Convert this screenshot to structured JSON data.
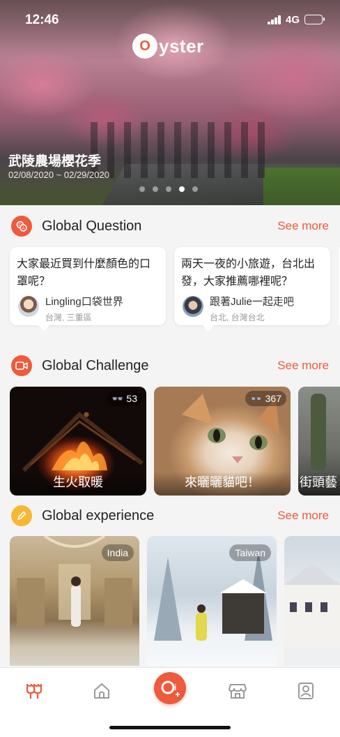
{
  "status_bar": {
    "time": "12:46",
    "network": "4G"
  },
  "brand": {
    "logo_mark": "O",
    "logo_text": "yster"
  },
  "hero": {
    "title": "武陵農場櫻花季",
    "date_range": "02/08/2020 ~ 02/29/2020",
    "pager": {
      "count": 5,
      "active_index": 3
    }
  },
  "colors": {
    "accent": "#ee5a3c",
    "experience_icon": "#f7b733"
  },
  "question": {
    "title": "Global Question",
    "see_more": "See more",
    "icon": "qa-bubbles-icon",
    "cards": [
      {
        "text": "大家最近買到什麼顏色的口罩呢？",
        "user": "Lingling口袋世界",
        "location": "台灣, 三重區"
      },
      {
        "text": "兩天一夜的小旅遊，台北出發，大家推薦哪裡呢？",
        "user": "跟著Julie一起走吧",
        "location": "台北, 台灣台北"
      }
    ]
  },
  "challenge": {
    "title": "Global Challenge",
    "see_more": "See more",
    "icon": "video-camera-icon",
    "cards": [
      {
        "caption": "生火取暖",
        "count": "53"
      },
      {
        "caption": "來曬曬貓吧！",
        "count": "367"
      },
      {
        "caption": "街頭藝"
      }
    ]
  },
  "experience": {
    "title": "Global experience",
    "see_more": "See more",
    "icon": "pencil-icon",
    "cards": [
      {
        "tag": "India"
      },
      {
        "tag": "Taiwan"
      },
      {
        "tag": ""
      }
    ]
  },
  "tabbar": {
    "items": [
      "tulips-icon",
      "home-icon",
      "post-icon",
      "store-icon",
      "profile-icon"
    ]
  }
}
